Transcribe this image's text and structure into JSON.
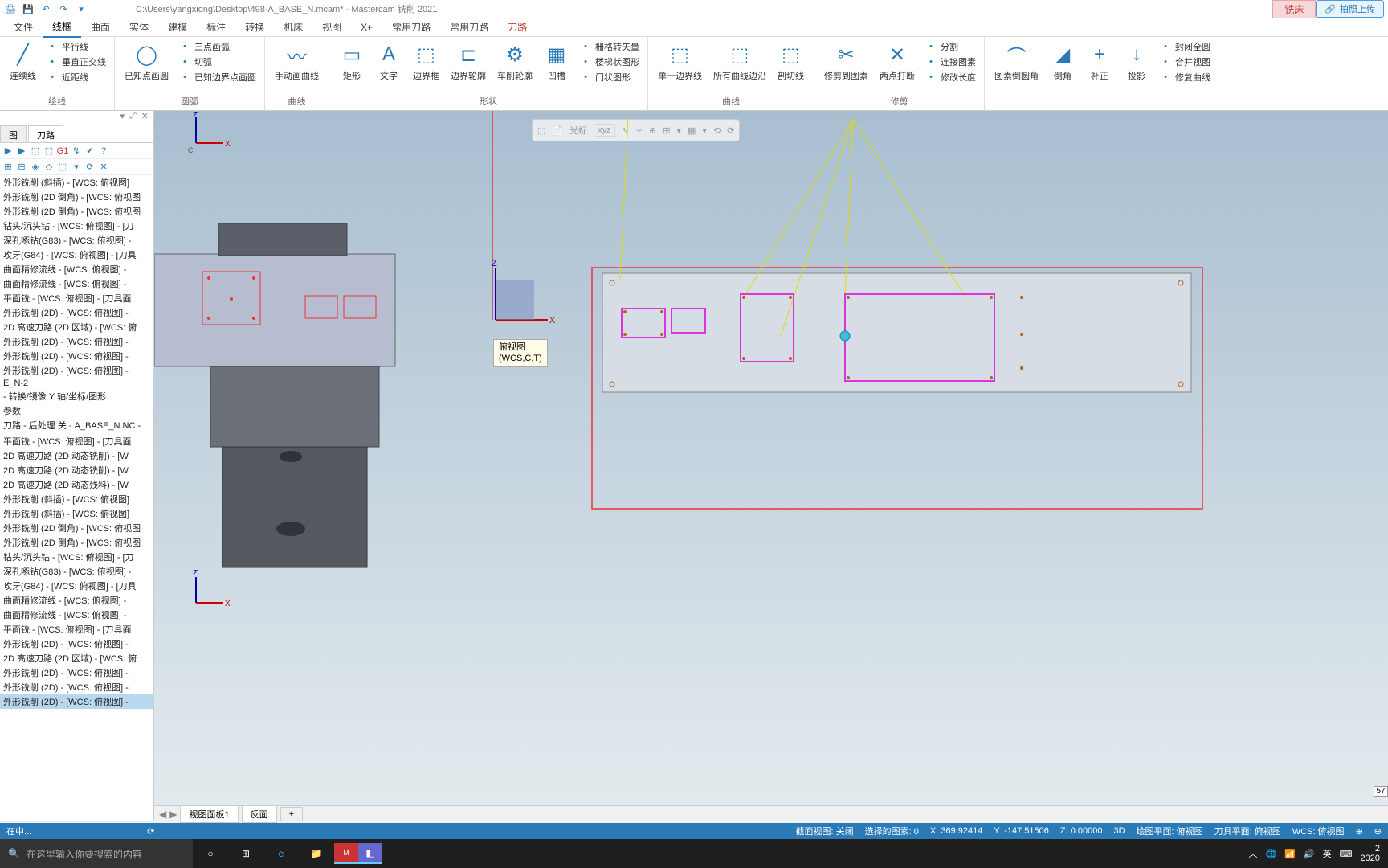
{
  "title_bar": {
    "file_path": "C:\\Users\\yangxiong\\Desktop\\498-A_BASE_N.mcam* - Mastercam 铣削 2021",
    "context_tab": "铣床",
    "upload": "拍照上传"
  },
  "menu_tabs": [
    "文件",
    "线框",
    "曲面",
    "实体",
    "建模",
    "标注",
    "转换",
    "机床",
    "视图",
    "X+",
    "常用刀路",
    "常用刀路",
    "刀路"
  ],
  "active_menu_index": 1,
  "ribbon": {
    "groups": [
      {
        "label": "绘线",
        "big": [
          {
            "icon": "╱",
            "lbl": "连续线"
          }
        ],
        "list": [
          "平行线",
          "垂直正交线",
          "近距线"
        ]
      },
      {
        "label": "圆弧",
        "big": [
          {
            "icon": "◯",
            "lbl": "已知点画圆"
          }
        ],
        "list": [
          "三点画弧",
          "切弧",
          "已知边界点画圆"
        ]
      },
      {
        "label": "曲线",
        "big": [
          {
            "icon": "〰",
            "lbl": "手动画曲线"
          }
        ]
      },
      {
        "label": "形状",
        "big": [
          {
            "icon": "▭",
            "lbl": "矩形"
          },
          {
            "icon": "A",
            "lbl": "文字"
          },
          {
            "icon": "⬚",
            "lbl": "边界框"
          },
          {
            "icon": "⊏",
            "lbl": "边界轮廓"
          },
          {
            "icon": "⚙",
            "lbl": "车削轮廓"
          },
          {
            "icon": "▦",
            "lbl": "凹槽"
          }
        ],
        "list": [
          "栅格转矢量",
          "楼梯状图形",
          "门状图形"
        ]
      },
      {
        "label": "曲线",
        "big": [
          {
            "icon": "⬚",
            "lbl": "单一边界线"
          },
          {
            "icon": "⬚",
            "lbl": "所有曲线边沿"
          },
          {
            "icon": "⬚",
            "lbl": "剖切线"
          }
        ]
      },
      {
        "label": "修剪",
        "big": [
          {
            "icon": "✂",
            "lbl": "修剪到图素"
          },
          {
            "icon": "✕",
            "lbl": "两点打断"
          }
        ],
        "list": [
          "分割",
          "连接图素",
          "修改长度"
        ]
      },
      {
        "label": "",
        "big": [
          {
            "icon": "⌒",
            "lbl": "图素倒圆角"
          },
          {
            "icon": "◢",
            "lbl": "倒角"
          },
          {
            "icon": "+",
            "lbl": "补正"
          },
          {
            "icon": "↓",
            "lbl": "投影"
          }
        ],
        "list": [
          "封闭全圆",
          "合并视图",
          "修复曲线"
        ]
      }
    ]
  },
  "panel": {
    "tabs": [
      "图",
      "刀路"
    ],
    "pin_icons": [
      "▾",
      "⤢",
      "✕"
    ]
  },
  "operations": [
    "外形铣削 (斜插) - [WCS: 俯视图]",
    "外形铣削 (2D 倒角) - [WCS: 俯视图",
    "外形铣削 (2D 倒角) - [WCS: 俯视图",
    "钻头/沉头钻 - [WCS: 俯视图] - [刀",
    "深孔啄钻(G83) - [WCS: 俯视图] -",
    "攻牙(G84) - [WCS: 俯视图] - [刀具",
    "曲面精修流线 - [WCS: 俯视图] -",
    "曲面精修流线 - [WCS: 俯视图] -",
    "平面铣 - [WCS: 俯视图] - [刀具面",
    "外形铣削 (2D) - [WCS: 俯视图] -",
    "2D 高速刀路 (2D 区域) - [WCS: 俯",
    "外形铣削 (2D) - [WCS: 俯视图] -",
    "外形铣削 (2D) - [WCS: 俯视图] -",
    "外形铣削 (2D) - [WCS: 俯视图] -",
    "E_N-2",
    "- 转换/镜像 Y 轴/坐标/图形",
    "参数",
    "刀路 - 后处理 关 - A_BASE_N.NC -",
    "",
    "平面铣 - [WCS: 俯视图] - [刀具面",
    "2D 高速刀路 (2D 动态铣削) - [W",
    "2D 高速刀路 (2D 动态铣削) - [W",
    "2D 高速刀路 (2D 动态残料) - [W",
    "外形铣削 (斜插) - [WCS: 俯视图]",
    "外形铣削 (斜插) - [WCS: 俯视图]",
    "外形铣削 (2D 倒角) - [WCS: 俯视图",
    "外形铣削 (2D 倒角) - [WCS: 俯视图",
    "钻头/沉头钻 - [WCS: 俯视图] - [刀",
    "深孔啄钻(G83) - [WCS: 俯视图] -",
    "攻牙(G84) - [WCS: 俯视图] - [刀具",
    "曲面精修流线 - [WCS: 俯视图] -",
    "曲面精修流线 - [WCS: 俯视图] -",
    "平面铣 - [WCS: 俯视图] - [刀具面",
    "外形铣削 (2D) - [WCS: 俯视图] -",
    "2D 高速刀路 (2D 区域) - [WCS: 俯",
    "外形铣削 (2D) - [WCS: 俯视图] -",
    "外形铣削 (2D) - [WCS: 俯视图] -",
    "外形铣削 (2D) - [WCS: 俯视图] -"
  ],
  "viewport": {
    "tabs": [
      "视图面板1",
      "反面",
      "+"
    ],
    "view_label_1": "俯视图",
    "view_label_2": "(WCS,C,T)",
    "toolbar_text": "光标",
    "toolbar_sub": "xyz",
    "right_meter": "57"
  },
  "status": {
    "loading": "在中...",
    "section": "截面视图: 关闭",
    "selected": "选择的图素: 0",
    "x": "X: 369.92414",
    "y": "Y: -147.51506",
    "z": "Z: 0.00000",
    "mode": "3D",
    "draw_plane": "绘图平面: 俯视图",
    "tool_plane": "刀具平面: 俯视图",
    "wcs": "WCS: 俯视图"
  },
  "taskbar": {
    "search_placeholder": "在这里输入你要搜索的内容",
    "ime": "英",
    "date1": "2",
    "date2": "2020"
  }
}
